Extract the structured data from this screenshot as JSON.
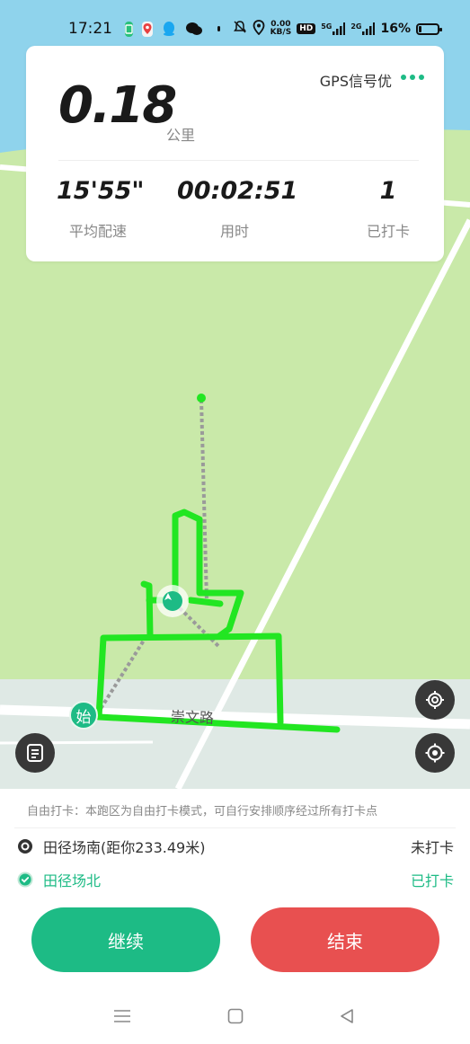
{
  "status_bar": {
    "time": "17:21",
    "net_speed_value": "0.00",
    "net_speed_unit": "KB/S",
    "hd_badge": "HD",
    "signal_1_label": "5G",
    "signal_2_label": "2G",
    "battery_percent": "16%",
    "battery_level": 0.16
  },
  "stats": {
    "gps_status": "GPS信号优",
    "distance": "0.18",
    "distance_unit": "公里",
    "pace": "15'55\"",
    "pace_label": "平均配速",
    "duration": "00:02:51",
    "duration_label": "用时",
    "checked_count": "1",
    "checked_label": "已打卡"
  },
  "map": {
    "road_label": "崇文路",
    "start_marker": "始",
    "colors": {
      "grass": "#c9e9a9",
      "water": "#8fd3ec",
      "ground": "#dfeae6",
      "track": "#22e622",
      "marker": "#1dbb85"
    }
  },
  "panel": {
    "notice": "自由打卡：本跑区为自由打卡模式，可自行安排顺序经过所有打卡点",
    "checkpoints": [
      {
        "name": "田径场南(距你233.49米)",
        "status": "未打卡",
        "color": "#333333"
      },
      {
        "name": "田径场北",
        "status": "已打卡",
        "color": "#1dbb85"
      }
    ],
    "continue_label": "继续",
    "end_label": "结束",
    "continue_color": "#1dbb85",
    "end_color": "#e85050"
  },
  "nav": {
    "menu_icon": "menu-icon",
    "home_icon": "home-icon",
    "back_icon": "back-icon"
  }
}
